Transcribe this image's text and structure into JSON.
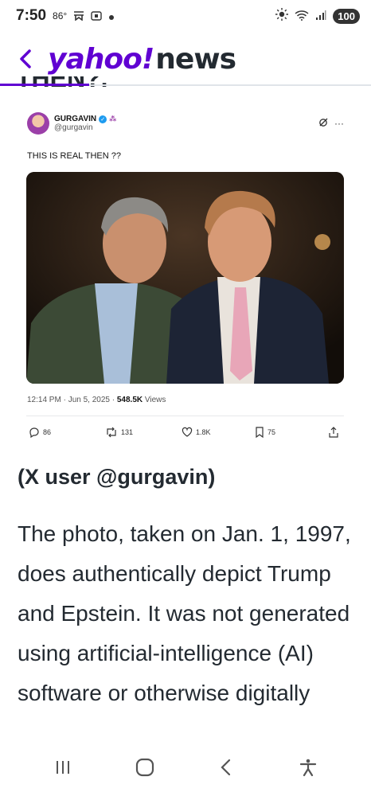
{
  "status_bar": {
    "time": "7:50",
    "temperature": "86°",
    "battery": "100"
  },
  "header": {
    "logo_primary": "yahoo!",
    "logo_secondary": "news",
    "cut_heading": "THEN?."
  },
  "tweet": {
    "author_name": "GURGAVIN",
    "author_handle": "@gurgavin",
    "text": "THIS IS REAL THEN ??",
    "timestamp": "12:14 PM · Jun 5, 2025 ·",
    "views_count": "548.5K",
    "views_label": "Views",
    "replies": "86",
    "reposts": "131",
    "likes": "1.8K",
    "bookmarks": "75"
  },
  "article": {
    "caption": "(X user @gurgavin)",
    "body": "The photo, taken on Jan. 1, 1997, does authentically depict Trump and Epstein. It was not generated using artificial-intelligence (AI) software or otherwise digitally"
  },
  "colors": {
    "brand": "#6001d2",
    "text": "#232a31",
    "verified": "#1d9bf0"
  }
}
